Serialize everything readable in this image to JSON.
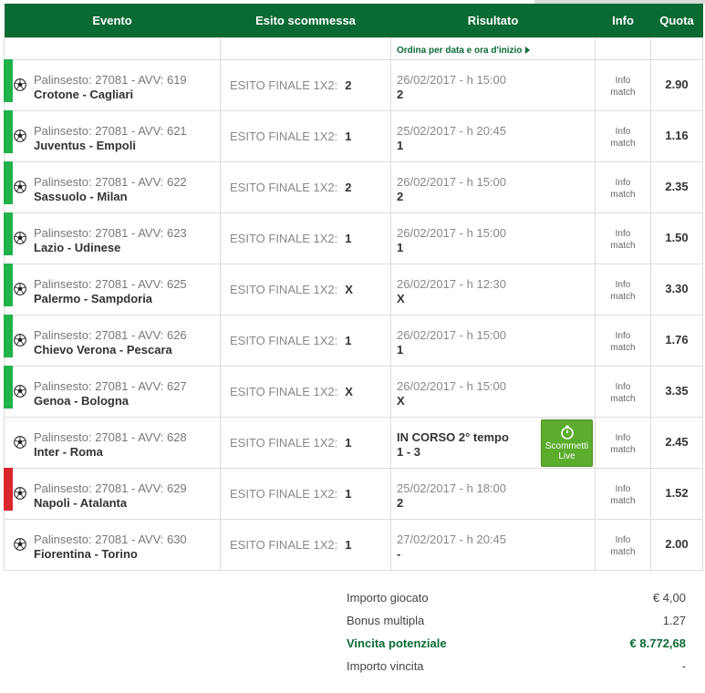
{
  "headers": {
    "evento": "Evento",
    "esito": "Esito scommessa",
    "risultato": "Risultato",
    "info": "Info",
    "quota": "Quota"
  },
  "sort_label": "Ordina per data e ora d'inizio",
  "colors": {
    "header_bg": "#0a6a33",
    "won": "#21b24b",
    "lost": "#d8262b",
    "live": "#5cac2e"
  },
  "bets": [
    {
      "palinsesto": "Palinsesto: 27081 - AVV: 619",
      "match": "Crotone - Cagliari",
      "esito_label": "ESITO FINALE 1X2:",
      "pick": "2",
      "when": "26/02/2017 - h 15:00",
      "result": "2",
      "info": "Info match",
      "quota": "2.90",
      "status": "won"
    },
    {
      "palinsesto": "Palinsesto: 27081 - AVV: 621",
      "match": "Juventus - Empoli",
      "esito_label": "ESITO FINALE 1X2:",
      "pick": "1",
      "when": "25/02/2017 - h 20:45",
      "result": "1",
      "info": "Info match",
      "quota": "1.16",
      "status": "won"
    },
    {
      "palinsesto": "Palinsesto: 27081 - AVV: 622",
      "match": "Sassuolo - Milan",
      "esito_label": "ESITO FINALE 1X2:",
      "pick": "2",
      "when": "26/02/2017 - h 15:00",
      "result": "2",
      "info": "Info match",
      "quota": "2.35",
      "status": "won"
    },
    {
      "palinsesto": "Palinsesto: 27081 - AVV: 623",
      "match": "Lazio - Udinese",
      "esito_label": "ESITO FINALE 1X2:",
      "pick": "1",
      "when": "26/02/2017 - h 15:00",
      "result": "1",
      "info": "Info match",
      "quota": "1.50",
      "status": "won"
    },
    {
      "palinsesto": "Palinsesto: 27081 - AVV: 625",
      "match": "Palermo - Sampdoria",
      "esito_label": "ESITO FINALE 1X2:",
      "pick": "X",
      "when": "26/02/2017 - h 12:30",
      "result": "X",
      "info": "Info match",
      "quota": "3.30",
      "status": "won"
    },
    {
      "palinsesto": "Palinsesto: 27081 - AVV: 626",
      "match": "Chievo Verona - Pescara",
      "esito_label": "ESITO FINALE 1X2:",
      "pick": "1",
      "when": "26/02/2017 - h 15:00",
      "result": "1",
      "info": "Info match",
      "quota": "1.76",
      "status": "won"
    },
    {
      "palinsesto": "Palinsesto: 27081 - AVV: 627",
      "match": "Genoa - Bologna",
      "esito_label": "ESITO FINALE 1X2:",
      "pick": "X",
      "when": "26/02/2017 - h 15:00",
      "result": "X",
      "info": "Info match",
      "quota": "3.35",
      "status": "won"
    },
    {
      "palinsesto": "Palinsesto: 27081 - AVV: 628",
      "match": "Inter - Roma",
      "esito_label": "ESITO FINALE 1X2:",
      "pick": "1",
      "when": "IN CORSO 2° tempo",
      "result": "1 - 3",
      "info": "Info match",
      "quota": "2.45",
      "status": "live",
      "live_button": "Scommetti Live"
    },
    {
      "palinsesto": "Palinsesto: 27081 - AVV: 629",
      "match": "Napoli - Atalanta",
      "esito_label": "ESITO FINALE 1X2:",
      "pick": "1",
      "when": "25/02/2017 - h 18:00",
      "result": "2",
      "info": "Info match",
      "quota": "1.52",
      "status": "lost"
    },
    {
      "palinsesto": "Palinsesto: 27081 - AVV: 630",
      "match": "Fiorentina - Torino",
      "esito_label": "ESITO FINALE 1X2:",
      "pick": "1",
      "when": "27/02/2017 - h 20:45",
      "result": "-",
      "info": "Info match",
      "quota": "2.00",
      "status": "pending"
    }
  ],
  "summary": {
    "importo_giocato_label": "Importo giocato",
    "importo_giocato": "€ 4,00",
    "bonus_label": "Bonus multipla",
    "bonus": "1.27",
    "vincita_label": "Vincita potenziale",
    "vincita": "€ 8.772,68",
    "importo_vincita_label": "Importo vincita",
    "importo_vincita": "-"
  }
}
